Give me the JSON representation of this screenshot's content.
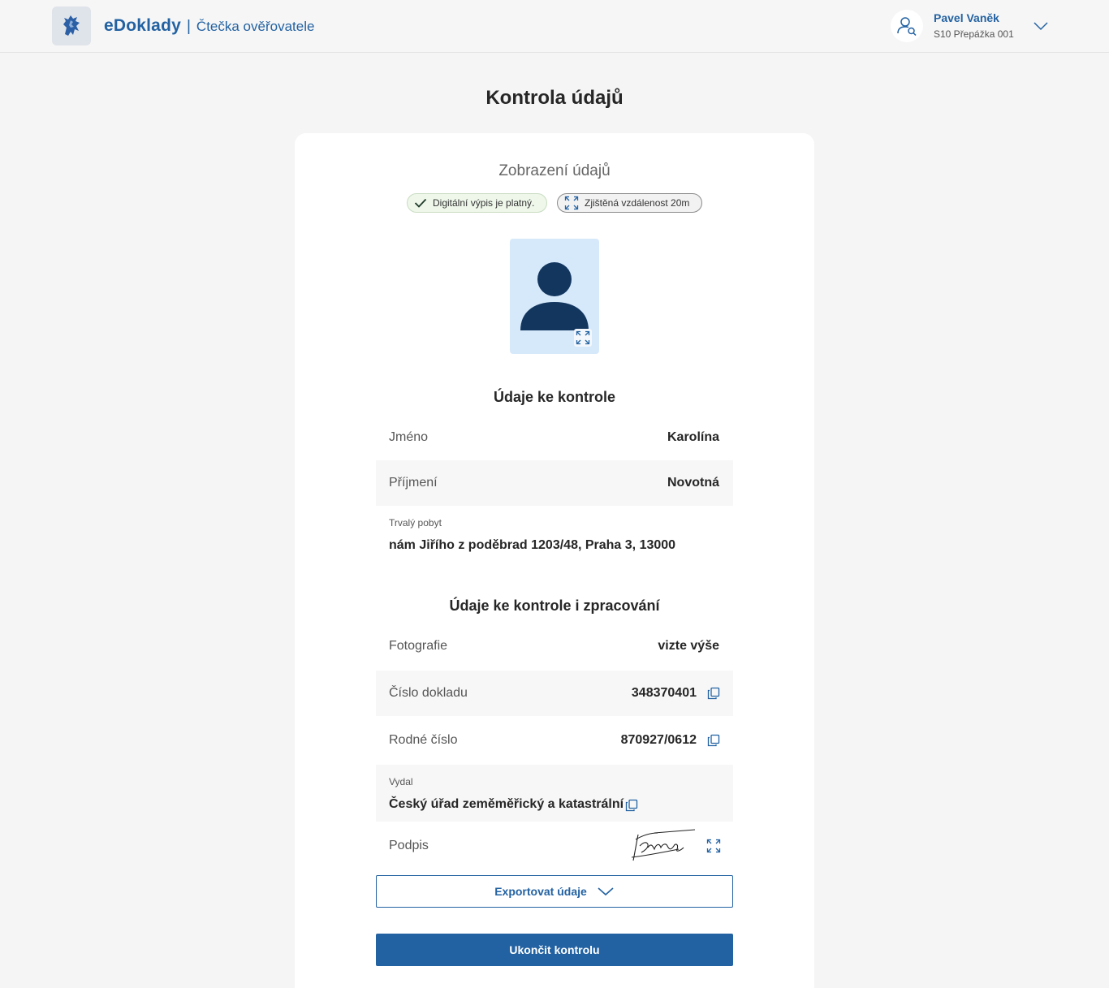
{
  "header": {
    "app_name": "eDoklady",
    "separator": "|",
    "app_subtitle": "Čtečka ověřovatele",
    "user_name": "Pavel Vaněk",
    "user_desk": "S10 Přepážka 001",
    "logo_icon": "lion-coat-of-arms-icon",
    "user_icon": "user-search-icon"
  },
  "page": {
    "title": "Kontrola údajů"
  },
  "display": {
    "subtitle": "Zobrazení údajů",
    "badge_valid": "Digitální výpis je platný.",
    "badge_distance": "Zjištěná vzdálenost 20m"
  },
  "check_section": {
    "title": "Údaje ke kontrole",
    "first_name_label": "Jméno",
    "first_name_value": "Karolína",
    "last_name_label": "Příjmení",
    "last_name_value": "Novotná",
    "residence_label": "Trvalý pobyt",
    "residence_value": "nám Jiřího z poděbrad 1203/48, Praha 3, 13000"
  },
  "process_section": {
    "title": "Údaje ke kontrole i zpracování",
    "photo_label": "Fotografie",
    "photo_value": "vizte výše",
    "doc_number_label": "Číslo dokladu",
    "doc_number_value": "348370401",
    "birth_number_label": "Rodné číslo",
    "birth_number_value": "870927/0612",
    "issuer_label": "Vydal",
    "issuer_value": "Český úřad zeměměřický a katastrální",
    "signature_label": "Podpis"
  },
  "actions": {
    "export_label": "Exportovat údaje",
    "finish_label": "Ukončit kontrolu"
  },
  "colors": {
    "brand_blue": "#2362a2",
    "valid_green_bg": "#eef7ea",
    "photo_bg": "#d6e9fb",
    "avatar_navy": "#13365f"
  }
}
